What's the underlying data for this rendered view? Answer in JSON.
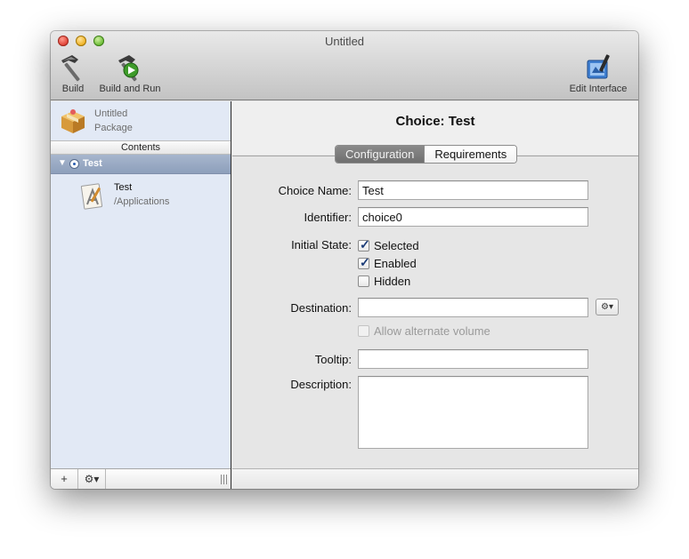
{
  "window": {
    "title": "Untitled"
  },
  "toolbar": {
    "build_label": "Build",
    "build_run_label": "Build and Run",
    "edit_interface_label": "Edit Interface"
  },
  "sidebar": {
    "package_name": "Untitled",
    "package_type": "Package",
    "contents_header": "Contents",
    "selected_choice": "Test",
    "item": {
      "name": "Test",
      "path": "/Applications"
    },
    "add_button": "+",
    "action_button": "⚙▾"
  },
  "main": {
    "title": "Choice: Test",
    "tabs": [
      {
        "label": "Configuration",
        "active": true
      },
      {
        "label": "Requirements",
        "active": false
      }
    ],
    "form": {
      "choice_name_label": "Choice Name:",
      "choice_name_value": "Test",
      "identifier_label": "Identifier:",
      "identifier_value": "choice0",
      "initial_state_label": "Initial State:",
      "selected_label": "Selected",
      "selected_checked": true,
      "enabled_label": "Enabled",
      "enabled_checked": true,
      "hidden_label": "Hidden",
      "hidden_checked": false,
      "destination_label": "Destination:",
      "destination_value": "",
      "destination_action": "⚙▾",
      "allow_alt_volume_label": "Allow alternate volume",
      "allow_alt_volume_checked": false,
      "tooltip_label": "Tooltip:",
      "tooltip_value": "",
      "description_label": "Description:",
      "description_value": ""
    }
  },
  "colors": {
    "sidebar_bg": "#e2e9f5",
    "selection_bg": "#98a8c2",
    "active_tab_bg": "#7d7d7d"
  }
}
